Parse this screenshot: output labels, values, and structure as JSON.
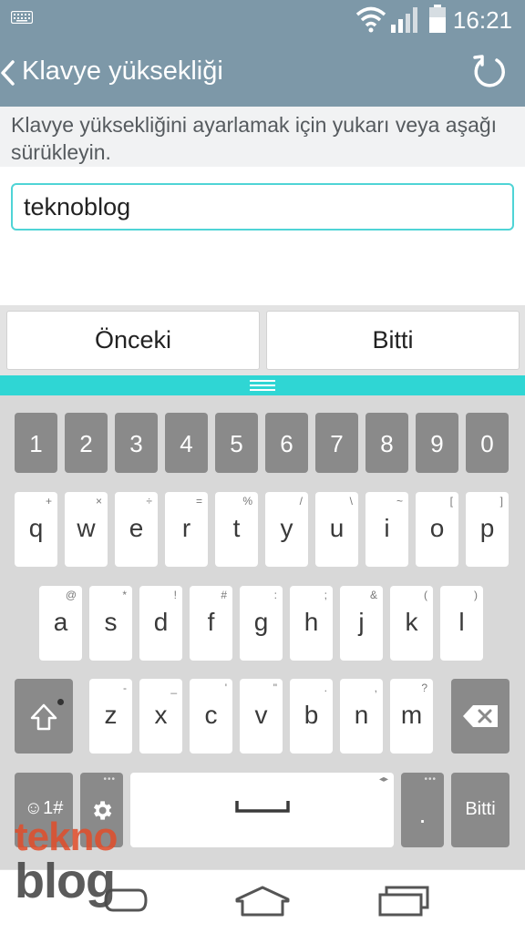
{
  "status_bar": {
    "time": "16:21",
    "icons": [
      "keyboard-indicator-icon",
      "wifi-icon",
      "signal-icon",
      "battery-icon"
    ]
  },
  "app_bar": {
    "title": "Klavye yüksekliği",
    "icons": [
      "back-chevron-icon",
      "reset-icon"
    ]
  },
  "description": "Klavye yüksekliğini ayarlamak için yukarı veya aşağı sürükleyin.",
  "text_field": {
    "value": "teknoblog"
  },
  "nav_buttons": {
    "previous": "Önceki",
    "done": "Bitti"
  },
  "keyboard": {
    "number_row": [
      "1",
      "2",
      "3",
      "4",
      "5",
      "6",
      "7",
      "8",
      "9",
      "0"
    ],
    "row1": [
      {
        "main": "q",
        "sec": "+"
      },
      {
        "main": "w",
        "sec": "×"
      },
      {
        "main": "e",
        "sec": "÷"
      },
      {
        "main": "r",
        "sec": "="
      },
      {
        "main": "t",
        "sec": "%"
      },
      {
        "main": "y",
        "sec": "/"
      },
      {
        "main": "u",
        "sec": "\\"
      },
      {
        "main": "i",
        "sec": "~"
      },
      {
        "main": "o",
        "sec": "["
      },
      {
        "main": "p",
        "sec": "]"
      }
    ],
    "row2": [
      {
        "main": "a",
        "sec": "@"
      },
      {
        "main": "s",
        "sec": "*"
      },
      {
        "main": "d",
        "sec": "!"
      },
      {
        "main": "f",
        "sec": "#"
      },
      {
        "main": "g",
        "sec": ":"
      },
      {
        "main": "h",
        "sec": ";"
      },
      {
        "main": "j",
        "sec": "&"
      },
      {
        "main": "k",
        "sec": "("
      },
      {
        "main": "l",
        "sec": ")"
      }
    ],
    "row3": [
      {
        "main": "z",
        "sec": "-"
      },
      {
        "main": "x",
        "sec": "_"
      },
      {
        "main": "c",
        "sec": "'"
      },
      {
        "main": "v",
        "sec": "\""
      },
      {
        "main": "b",
        "sec": "."
      },
      {
        "main": "n",
        "sec": ","
      },
      {
        "main": "m",
        "sec": "?"
      }
    ],
    "symbols_label": "☺1#",
    "period_label": ".",
    "done_label": "Bitti",
    "icons": [
      "shift-icon",
      "backspace-icon",
      "settings-gear-icon",
      "space-icon"
    ]
  },
  "navigation_bar": {
    "icons": [
      "back-icon",
      "home-icon",
      "recent-apps-icon"
    ]
  },
  "watermark": {
    "line1": "tekno",
    "line2": "blog"
  },
  "colors": {
    "app_bar": "#7d98a8",
    "accent": "#2fd6d4",
    "field_border": "#4fd4d6",
    "gray_key": "#8a8a8a",
    "keyboard_bg": "#d8d8d8"
  }
}
